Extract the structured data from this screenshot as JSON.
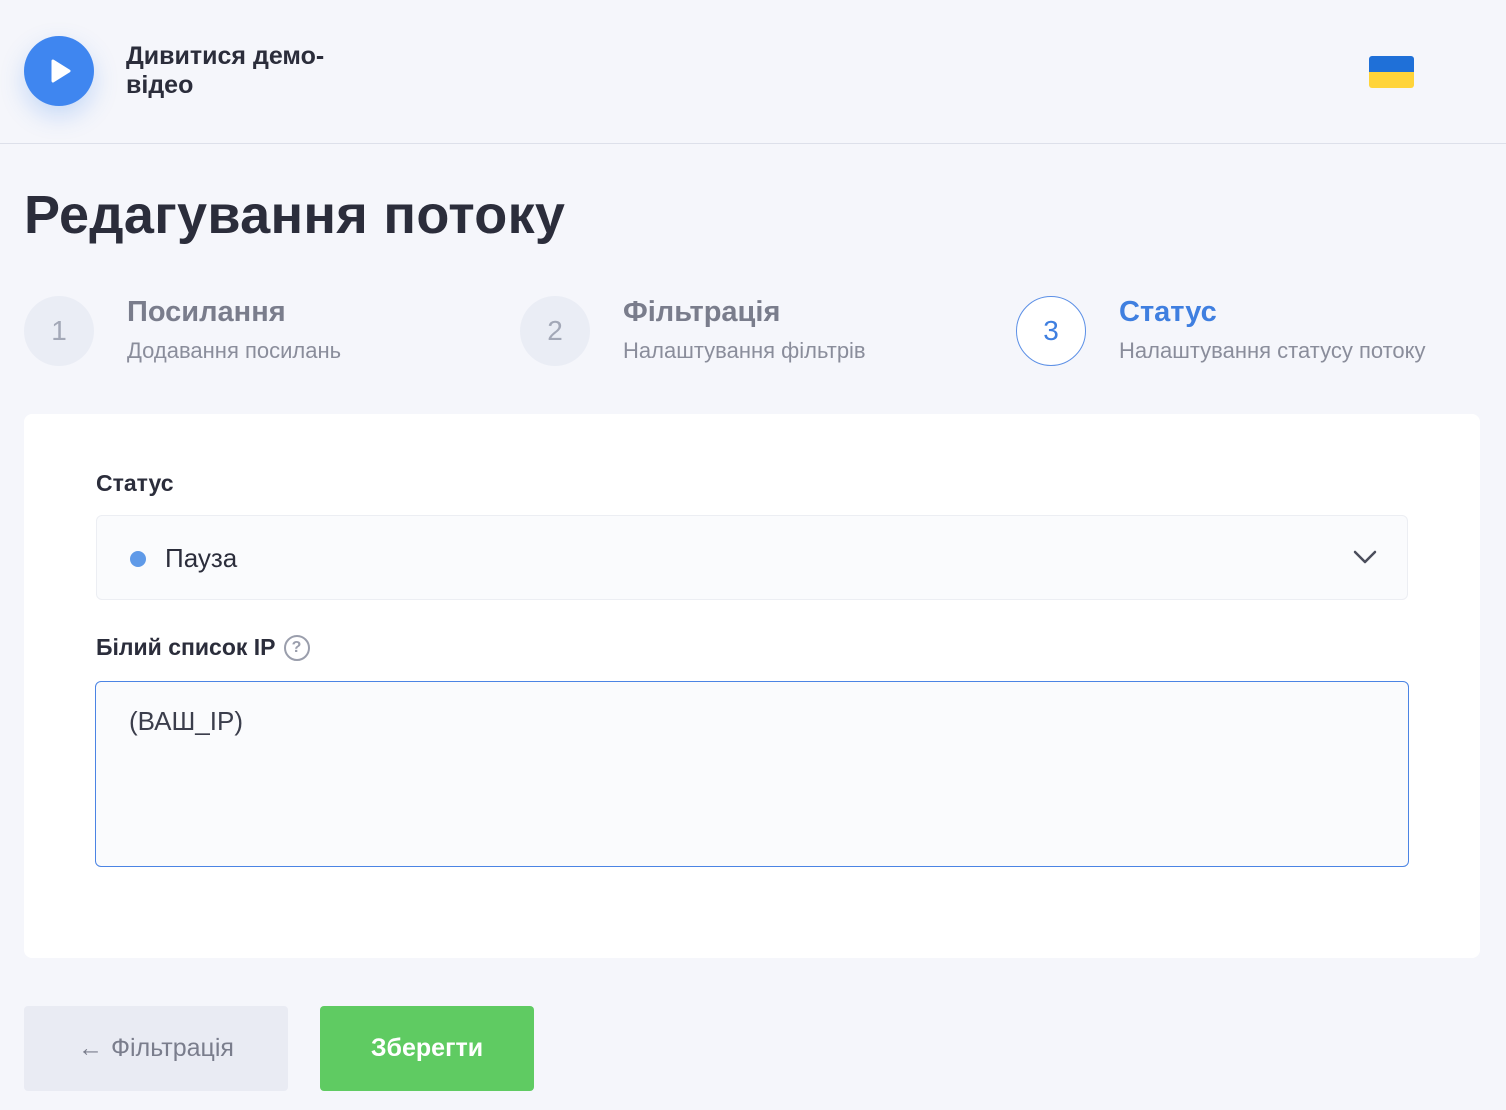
{
  "header": {
    "demo_video_label": "Дивитися демо-відео",
    "language_flag": "ua-flag-icon"
  },
  "page": {
    "title": "Редагування потоку"
  },
  "steps": [
    {
      "number": "1",
      "title": "Посилання",
      "subtitle": "Додавання посилань",
      "active": false
    },
    {
      "number": "2",
      "title": "Фільтрація",
      "subtitle": "Налаштування фільтрів",
      "active": false
    },
    {
      "number": "3",
      "title": "Статус",
      "subtitle": "Налаштування статусу потоку",
      "active": true
    }
  ],
  "form": {
    "status_label": "Статус",
    "status_value": "Пауза",
    "status_dot_color": "#5f9ae8",
    "whitelist_label": "Білий список IP",
    "whitelist_value": "(ВАШ_IP)"
  },
  "footer": {
    "back_arrow": "←",
    "back_label": "Фільтрація",
    "save_label": "Зберегти"
  },
  "colors": {
    "accent": "#3f86f0",
    "save": "#5fcb62",
    "background": "#f5f6fb"
  }
}
